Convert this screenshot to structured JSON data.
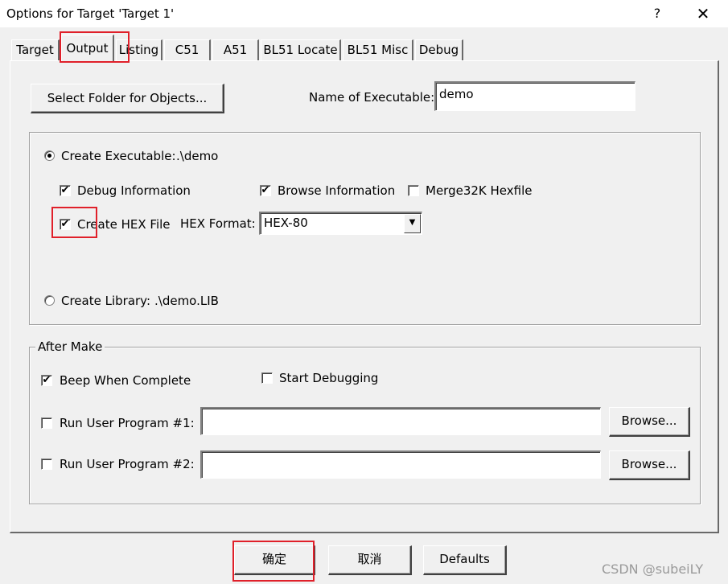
{
  "window": {
    "title": "Options for Target 'Target 1'",
    "help_label": "?",
    "close_label": "✕"
  },
  "tabs": [
    {
      "label": "Target",
      "active": false
    },
    {
      "label": "Output",
      "active": true
    },
    {
      "label": "Listing",
      "active": false
    },
    {
      "label": "C51",
      "active": false
    },
    {
      "label": "A51",
      "active": false
    },
    {
      "label": "BL51 Locate",
      "active": false
    },
    {
      "label": "BL51 Misc",
      "active": false
    },
    {
      "label": "Debug",
      "active": false
    }
  ],
  "output": {
    "select_folder_label": "Select Folder for Objects...",
    "name_exec_label": "Name of Executable:",
    "name_exec_value": "demo",
    "create_exec": {
      "label": "Create Executable:",
      "path": ".\\demo",
      "selected": true
    },
    "debug_info": {
      "label": "Debug Information",
      "checked": true
    },
    "browse_info": {
      "label": "Browse Information",
      "checked": true
    },
    "merge_hex": {
      "label": "Merge32K Hexfile",
      "checked": false
    },
    "create_hex": {
      "label": "Create HEX File",
      "checked": true
    },
    "hex_format_label": "HEX Format:",
    "hex_format_value": "HEX-80",
    "create_lib": {
      "label": "Create Library:",
      "path": ".\\demo.LIB",
      "selected": false
    }
  },
  "after_make": {
    "legend": "After Make",
    "beep": {
      "label": "Beep When Complete",
      "checked": true
    },
    "start_debug": {
      "label": "Start Debugging",
      "checked": false
    },
    "run1": {
      "label": "Run User Program #1:",
      "checked": false,
      "value": "",
      "browse_label": "Browse..."
    },
    "run2": {
      "label": "Run User Program #2:",
      "checked": false,
      "value": "",
      "browse_label": "Browse..."
    }
  },
  "footer": {
    "ok_label": "确定",
    "cancel_label": "取消",
    "defaults_label": "Defaults"
  },
  "watermark": "CSDN @subeiLY",
  "check_mark": "✔",
  "colors": {
    "highlight": "#e0202a",
    "face": "#f0f0f0"
  }
}
